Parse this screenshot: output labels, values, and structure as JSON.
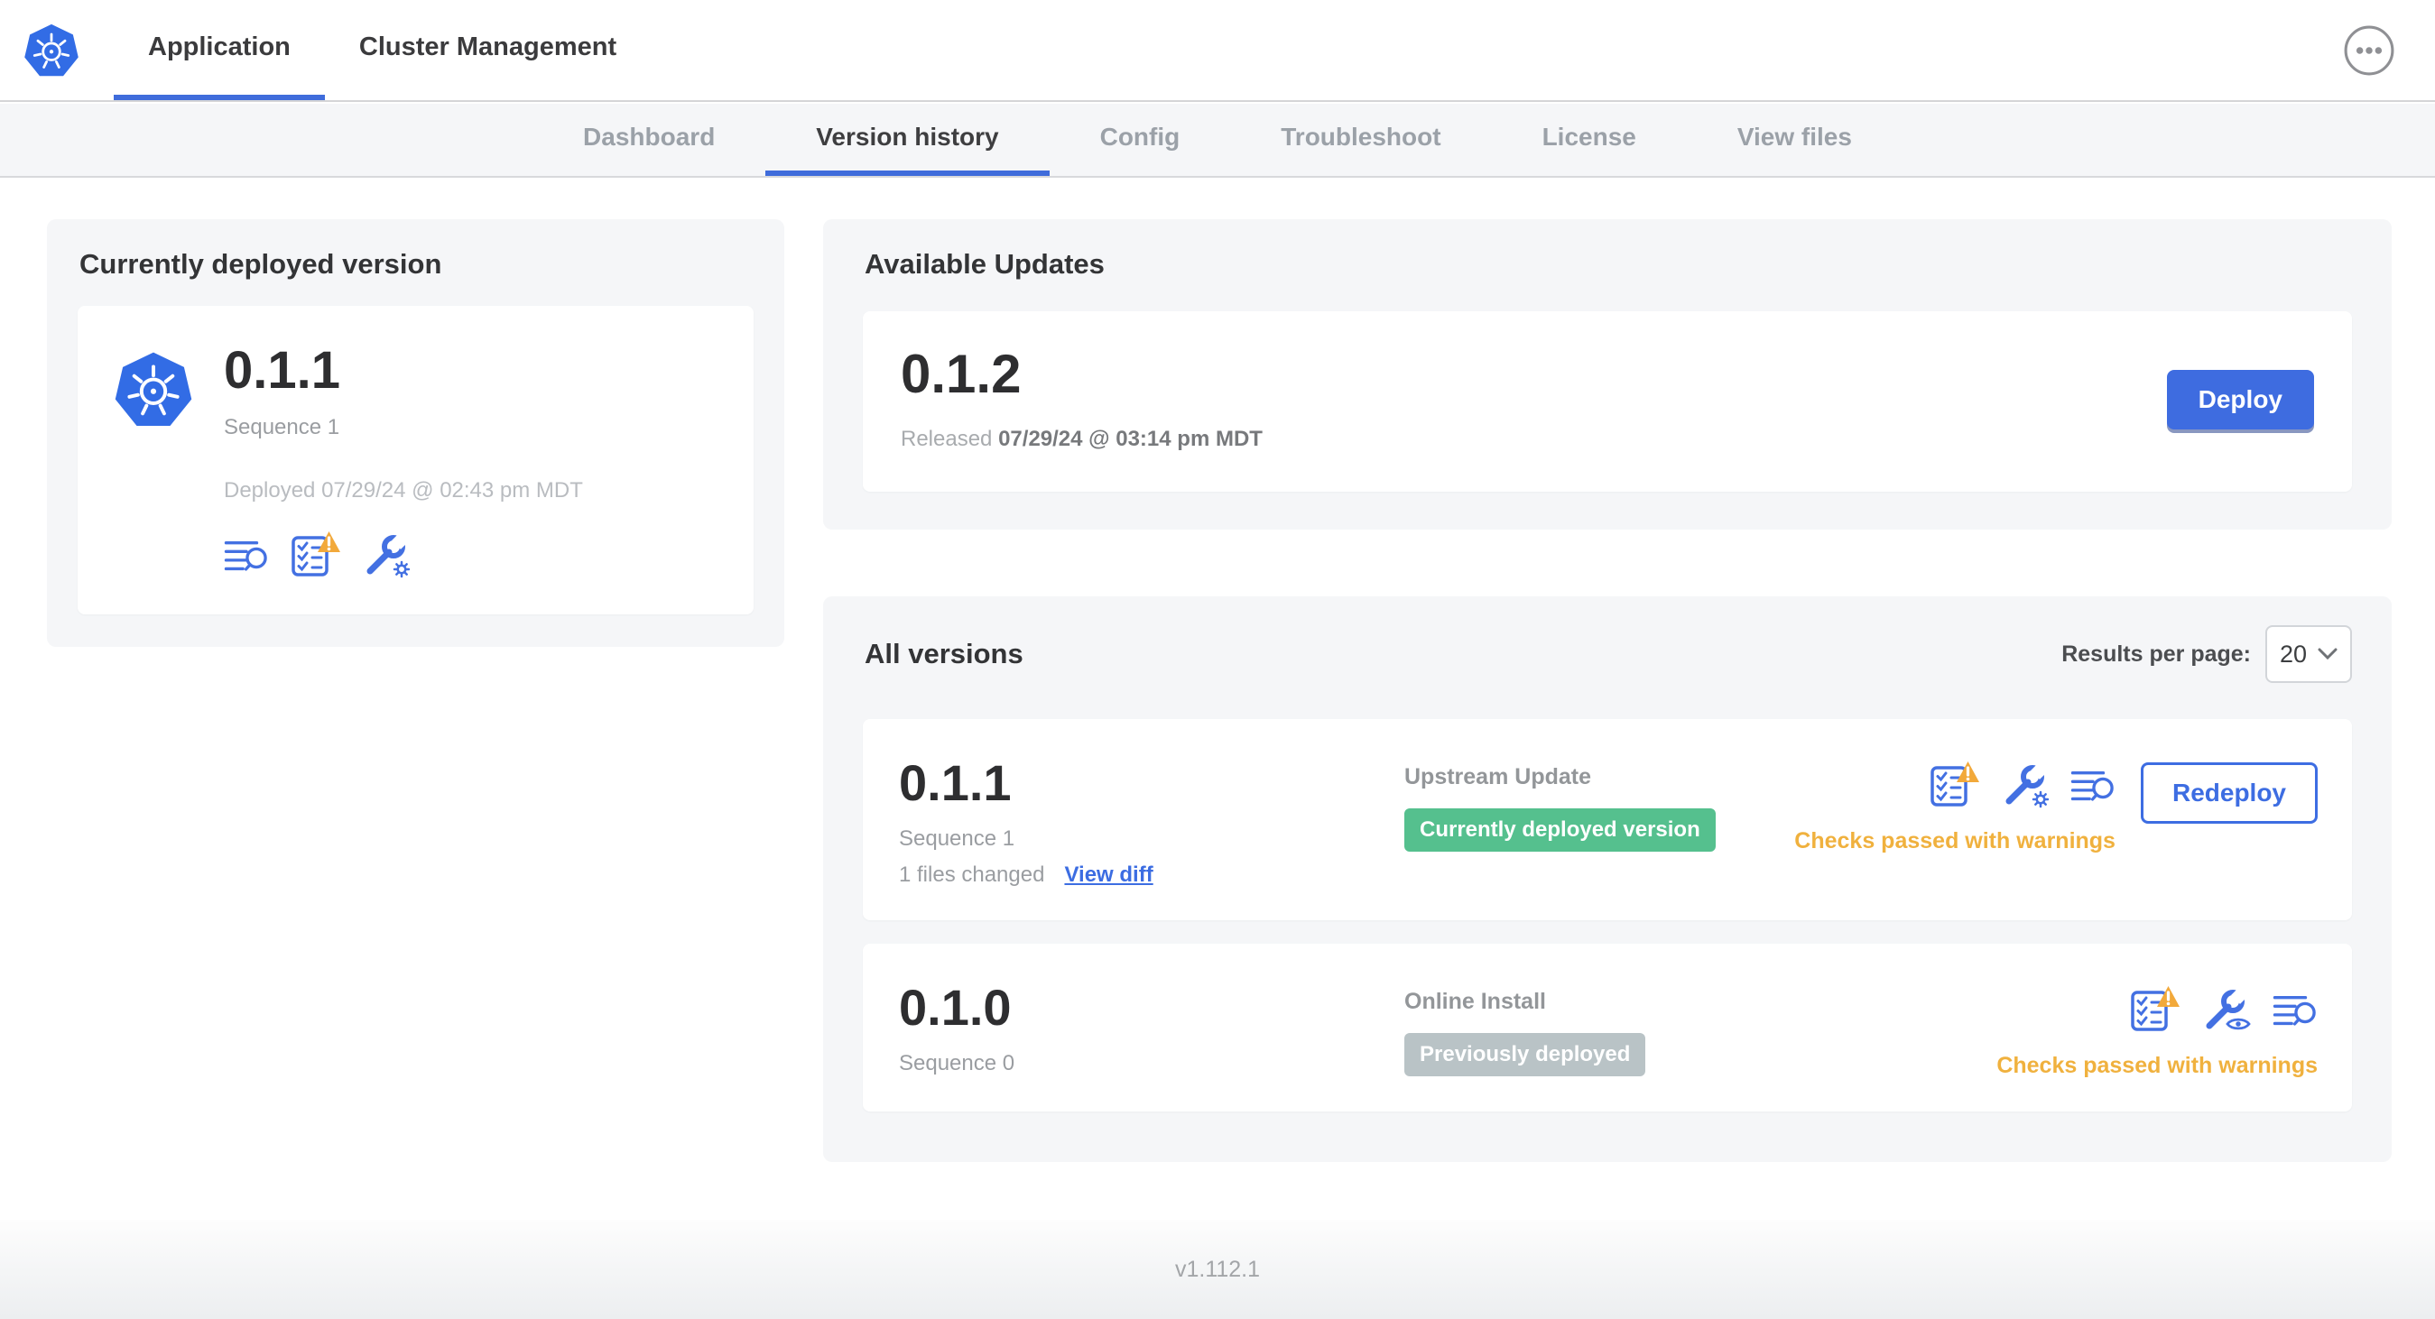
{
  "header": {
    "tabs": [
      {
        "label": "Application",
        "active": true
      },
      {
        "label": "Cluster Management",
        "active": false
      }
    ],
    "menu_icon": "ellipsis-icon"
  },
  "subnav": {
    "items": [
      {
        "label": "Dashboard",
        "active": false
      },
      {
        "label": "Version history",
        "active": true
      },
      {
        "label": "Config",
        "active": false
      },
      {
        "label": "Troubleshoot",
        "active": false
      },
      {
        "label": "License",
        "active": false
      },
      {
        "label": "View files",
        "active": false
      }
    ]
  },
  "currently_deployed": {
    "title": "Currently deployed version",
    "version": "0.1.1",
    "sequence": "Sequence 1",
    "deployed": "Deployed 07/29/24 @ 02:43 pm MDT",
    "icons": [
      "logs-icon",
      "preflight-checks-icon",
      "edit-config-icon"
    ]
  },
  "available_updates": {
    "title": "Available Updates",
    "version": "0.1.2",
    "released_label": "Released",
    "released_date": "07/29/24 @ 03:14 pm MDT",
    "deploy_button": "Deploy"
  },
  "all_versions": {
    "title": "All versions",
    "results_per_page_label": "Results per page:",
    "results_per_page_value": "20",
    "rows": [
      {
        "version": "0.1.1",
        "sequence": "Sequence 1",
        "files_changed": "1 files changed",
        "view_diff": "View diff",
        "source": "Upstream Update",
        "status_badge": "Currently deployed version",
        "badge_style": "green",
        "icons": [
          "preflight-checks-icon",
          "edit-config-icon",
          "logs-icon"
        ],
        "checks": "Checks passed with warnings",
        "action_button": "Redeploy"
      },
      {
        "version": "0.1.0",
        "sequence": "Sequence 0",
        "source": "Online Install",
        "status_badge": "Previously deployed",
        "badge_style": "gray",
        "icons": [
          "preflight-checks-icon",
          "view-config-icon",
          "logs-icon"
        ],
        "checks": "Checks passed with warnings"
      }
    ]
  },
  "footer": {
    "version": "v1.112.1"
  },
  "colors": {
    "accent_blue": "#3d6de2",
    "kubernetes_blue": "#326ce5",
    "success_green": "#55c08e",
    "neutral_badge_gray": "#b9c3c6",
    "warning_amber": "#f0b13e",
    "card_gray": "#f5f6f8"
  }
}
